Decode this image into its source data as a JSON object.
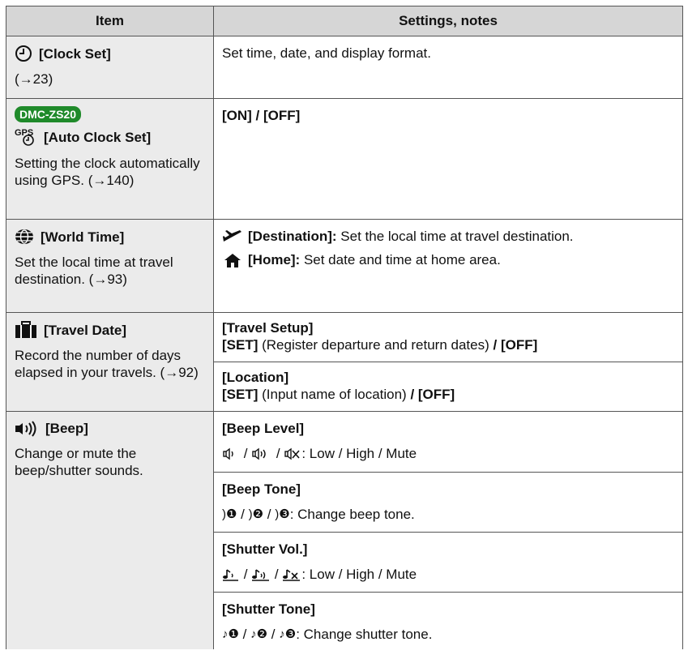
{
  "header": {
    "item": "Item",
    "settings": "Settings, notes"
  },
  "clock_set": {
    "title": "[Clock Set]",
    "ref": "(→23)",
    "desc": "Set time, date, and display format."
  },
  "auto_clock": {
    "model": "DMC-ZS20",
    "gps": "GPS",
    "title": "[Auto Clock Set]",
    "note": "Setting the clock automatically using GPS. (→140)",
    "value": "[ON] / [OFF]"
  },
  "world_time": {
    "title": "[World Time]",
    "note": "Set the local time at travel destination. (→93)",
    "dest_label": "[Destination]:",
    "dest_text": " Set the local time at travel destination.",
    "home_label": "[Home]:",
    "home_text": " Set date and time at home area."
  },
  "travel_date": {
    "title": "[Travel Date]",
    "note": "Record the number of days elapsed in your travels. (→92)",
    "setup_title": "[Travel Setup]",
    "setup_set": "[SET]",
    "setup_text": " (Register departure and return dates) ",
    "setup_off": "/ [OFF]",
    "location_title": "[Location]",
    "location_set": "[SET]",
    "location_text": " (Input name of location) ",
    "location_off": "/ [OFF]"
  },
  "beep": {
    "title": "[Beep]",
    "note": "Change or mute the beep/shutter sounds.",
    "level_title": "[Beep Level]",
    "level_text": ": Low / High / Mute",
    "tone_title": "[Beep Tone]",
    "tone_text": " : Change beep tone.",
    "vol_title": "[Shutter Vol.]",
    "vol_text": " : Low / High / Mute",
    "stone_title": "[Shutter Tone]",
    "stone_text": " : Change shutter tone.",
    "tone_glyphs": [
      "❶",
      "❷",
      "❸"
    ]
  }
}
